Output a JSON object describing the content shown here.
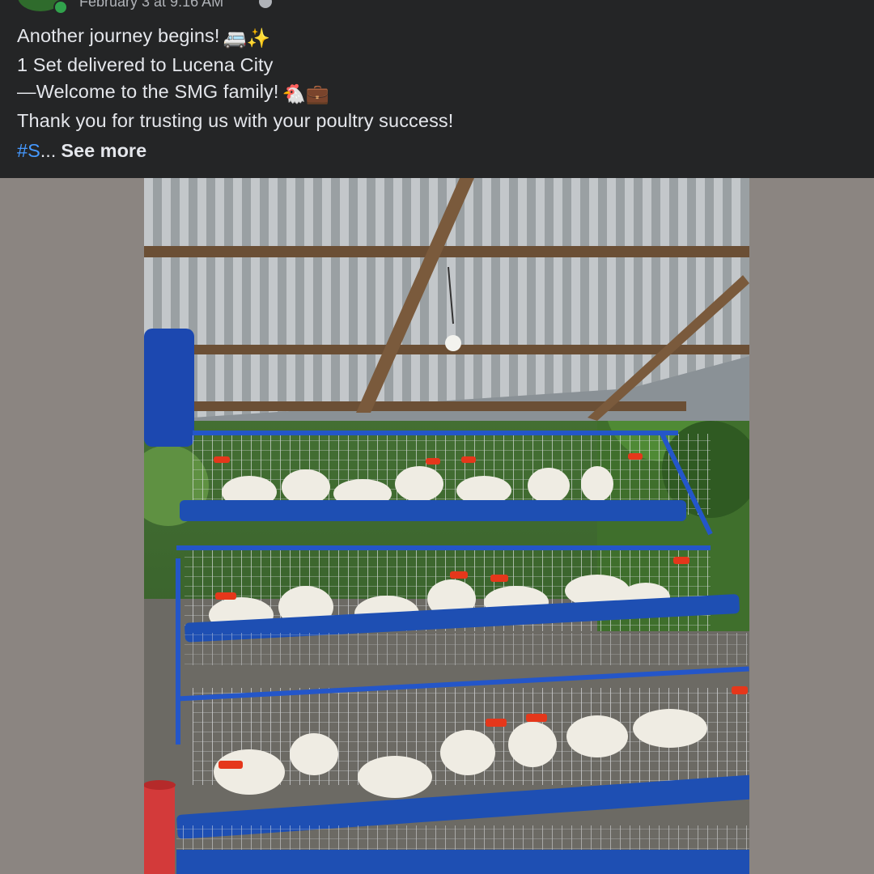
{
  "post": {
    "timestamp": "February 3 at 9:16 AM",
    "lines": [
      "Another journey begins!",
      "1 Set delivered to Lucena City",
      "—Welcome to the SMG family!",
      "Thank you for trusting us with your poultry success!"
    ],
    "line1_emoji": "🚐✨",
    "line3_emoji": "🐔💼",
    "hashtag": "#S",
    "ellipsis": "...",
    "see_more_label": "See more"
  },
  "icons": {
    "avatar": "page-avatar-icon",
    "online": "online-status-icon",
    "audience": "globe-icon"
  },
  "colors": {
    "header_bg": "#242526",
    "text": "#e4e6eb",
    "hashtag": "#4599ff",
    "page_bg": "#8b8581",
    "cage_blue": "#1e4fb3"
  }
}
